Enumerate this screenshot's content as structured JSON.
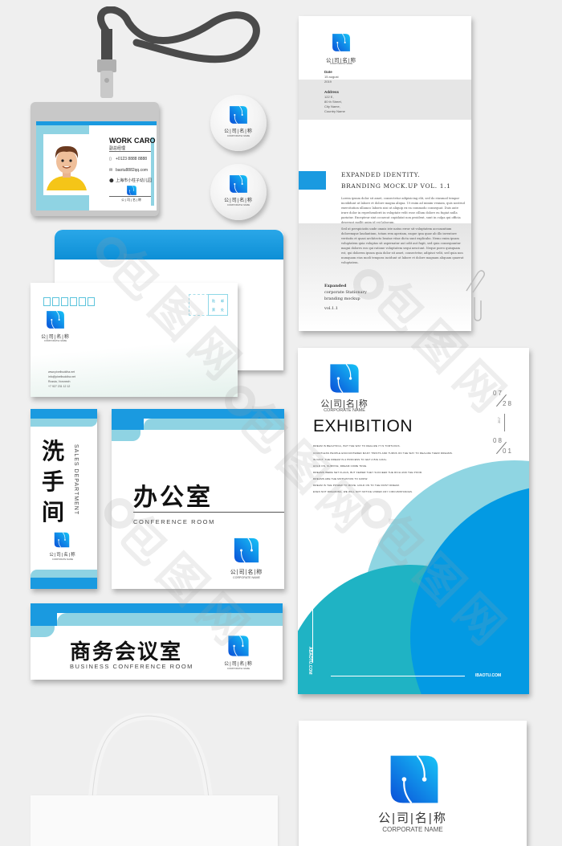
{
  "brand": {
    "cn_name": "公|司|名|称",
    "en_name": "CORPORATE NAME",
    "colors": {
      "primary_blue": "#1a9ae0",
      "light_cyan": "#8fd3e3",
      "teal": "#1fb3c4",
      "logo_gradient_start": "#0a4fd8",
      "logo_gradient_end": "#16c5f7",
      "background": "#efefef"
    }
  },
  "id_card": {
    "title": "WORK CARO",
    "subtitle": "副总经理",
    "phone": "+0123 8888 8888",
    "email": "baotu8882qq.com",
    "address": "上海市小柱子幼儿园",
    "phone_icon": "phone-icon",
    "mail_icon": "mail-icon",
    "location_icon": "location-pin-icon"
  },
  "letterhead": {
    "date_label": "Date",
    "date_value": "15 august 2019",
    "address_label": "Address",
    "address_lines": [
      "122 E,",
      "80 th Street,",
      "City Name,",
      "Country Name"
    ],
    "heading_line1": "EXPANDED IDENTITY.",
    "heading_line2": "BRANDING MOCK.UP VOL. 1.1",
    "paragraph1": "Lorem ipsum dolor sit amet, consectetur adipisicing elit, sed do eiusmod tempor incididunt ut labore et dolore magna aliqua. Ut enim ad minim veniam, quis nostrud exercitation ullamco laboris nisi ut aliquip ex ea commodo consequat. Duis aute irure dolor in reprehenderit in voluptate velit esse cillum dolore eu fugiat nulla pariatur. Excepteur sint occaecat cupidatat non proident, sunt in culpa qui officia deserunt mollit anim id est laborum.",
    "paragraph2": "Sed ut perspiciatis unde omnis iste natus error sit voluptatem accusantium doloremque laudantium, totam rem aperiam, eaque ipsa quae ab illo inventore veritatis et quasi architecto beatae vitae dicta sunt explicabo. Nemo enim ipsam voluptatem quia voluptas sit aspernatur aut odit aut fugit, sed quia consequuntur magni dolores eos qui ratione voluptatem sequi nesciunt. Neque porro quisquam est, qui dolorem ipsum quia dolor sit amet, consectetur, adipisci velit, sed quia non numquam eius modi tempora incidunt ut labore et dolore magnam aliquam quaerat voluptatem.",
    "footer_bold": "Expanded",
    "footer_line2": "corporate Stationary",
    "footer_line3": "branding mockup",
    "footer_vol": "vol.1.1"
  },
  "envelope": {
    "stamp_chars": [
      "贴",
      "邮",
      "票",
      "处"
    ],
    "contact_lines": [
      "www.pixelbuddha.net",
      "info@pixelbuddha.net",
      "Russia, Voronezh",
      "+7 927 231 12 12"
    ]
  },
  "vertical_sign": {
    "title_chars": [
      "洗",
      "手",
      "间"
    ],
    "vertical_text": "SALES DEPARTMENT"
  },
  "office_sign": {
    "title": "办公室",
    "subtitle": "CONFERENCE ROOM"
  },
  "business_sign": {
    "title": "商务会议室",
    "subtitle": "BUSINESS CONFERENCE ROOM"
  },
  "poster": {
    "title": "EXHIBITION",
    "body_lines": [
      "DREAM IS BEAUTIFUL, BUT THE WAY TO REALIZE IT IS TORTUOUS.",
      "COUNTLESS PEOPLE ENCOUNTERED MANY TWISTS AND TURNS ON THE WAY TO REALIZE THEIR DREAMS.",
      "IN FACT, THE DREAM IS A PROCESS TO GET A BIG GOAL.",
      "HOLD ON, SURVIVE, DREAM COME TRUE.",
      "DREAMS WERE SET FLAGS, BUT FEWER THEY SUCCEED THE RICH AND THE POOR.",
      "DREAMS ARE THE MOTIVATION TO GROW.",
      "DREAM IS THE POWER TO MOVE. HOLD ON TO THE FIRST DREAM.",
      "EVEN NOT DREAMING, WE WILL NOT NOTICE UNDER ANY CIRCUMSTANCES."
    ],
    "date_start_month": "07",
    "date_start_day": "28",
    "year": "2017",
    "date_end_month": "08",
    "date_end_day": "01",
    "url_vertical": "ABAOTU.COM",
    "url_horizontal": "IBAOTU.COM"
  },
  "watermark": {
    "text": "包图网"
  }
}
